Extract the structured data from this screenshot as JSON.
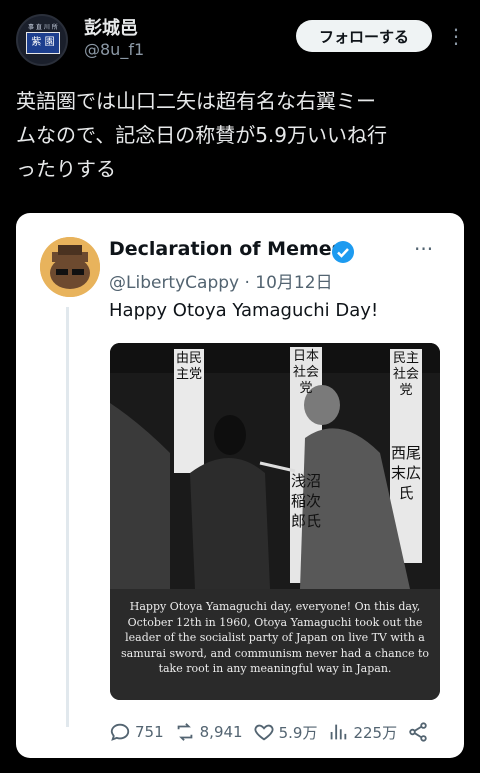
{
  "user": {
    "name": "彭城邑",
    "handle": "@8u_f1",
    "avatar_sign": "紫 園",
    "avatar_sign_top": "事 直 川 所"
  },
  "header": {
    "follow_label": "フォローする",
    "more_label": "⋮"
  },
  "tweet": {
    "text": "英語圏では山口二矢は超有名な右翼ミー\nムなので、記念日の称賛が5.9万いいね行\nったりする"
  },
  "quoted": {
    "name": "Declaration of Memes",
    "handle_date": "@LibertyCappy · 10月12日",
    "text": "Happy Otoya Yamaguchi Day!",
    "more_label": "···",
    "image": {
      "caption": "Happy Otoya Yamaguchi day, everyone! On this day, October 12th in 1960, Otoya Yamaguchi took out the leader of the socialist party of Japan on live TV with a samurai sword, and communism never had a chance to take root in any meaningful way in Japan.",
      "banners": [
        "由民主党",
        "日本社会党",
        "浅沼稲次郎氏",
        "民主社会党",
        "西尾末広氏"
      ]
    },
    "stats": {
      "replies": "751",
      "retweets": "8,941",
      "likes": "5.9万",
      "views": "225万"
    }
  },
  "colors": {
    "background": "#000000",
    "card": "#ffffff",
    "accent": "#1d9bf0",
    "secondary_text": "#536471"
  },
  "icons": [
    "reply-icon",
    "retweet-icon",
    "like-icon",
    "views-icon",
    "share-icon",
    "verified-badge-icon"
  ]
}
